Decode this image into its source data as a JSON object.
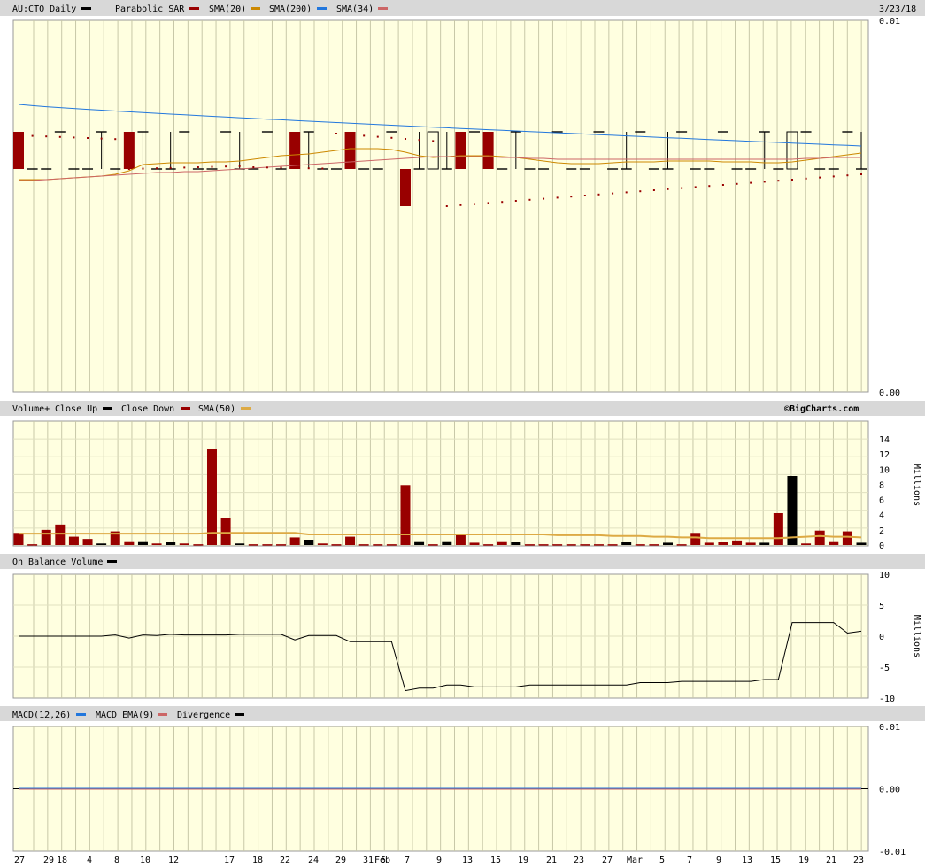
{
  "colors": {
    "panel_bg": "#FFFFE0",
    "header_bg": "#D8D8D8",
    "up": "#000000",
    "down": "#990000",
    "sma20": "#CC8800",
    "sma200": "#2277DD",
    "sma34": "#CC6666",
    "volume_sma50": "#DDAA44",
    "macd": "#2277DD",
    "macd_ema": "#CC6666",
    "divergence": "#000000",
    "sar": "#990000"
  },
  "price_panel": {
    "title": "AU:CTO Daily",
    "date": "3/23/18",
    "legend": [
      "Parabolic SAR",
      "SMA(20)",
      "SMA(200)",
      "SMA(34)"
    ],
    "legend_colors": [
      "#990000",
      "#CC8800",
      "#2277DD",
      "#CC6666"
    ],
    "y_top_label": "0.01",
    "y_bottom_label": "0.00"
  },
  "volume_panel": {
    "title": "Volume+",
    "legend": [
      "Close Up",
      "Close Down",
      "SMA(50)"
    ],
    "legend_colors": [
      "#000000",
      "#990000",
      "#DDAA44"
    ],
    "credit": "©BigCharts.com",
    "unit": "Millions",
    "ticks": [
      "14",
      "12",
      "10",
      "8",
      "6",
      "4",
      "2",
      "0"
    ]
  },
  "obv_panel": {
    "title": "On Balance Volume",
    "unit": "Millions",
    "ticks": [
      "10",
      "5",
      "0",
      "-5",
      "-10"
    ]
  },
  "macd_panel": {
    "title": "MACD(12,26)",
    "legend": [
      "MACD EMA(9)",
      "Divergence"
    ],
    "legend_colors": [
      "#2277DD",
      "#CC6666",
      "#000000"
    ],
    "ticks": [
      "0.01",
      "0.00",
      "-0.01"
    ]
  },
  "x_axis": {
    "labels": [
      "27",
      "29",
      "18",
      "4",
      "8",
      "10",
      "12",
      "17",
      "18",
      "22",
      "24",
      "29",
      "31",
      "Feb",
      "5",
      "7",
      "9",
      "13",
      "15",
      "19",
      "21",
      "23",
      "27",
      "Mar",
      "5",
      "7",
      "9",
      "13",
      "15",
      "19",
      "21",
      "23"
    ]
  },
  "chart_data": [
    {
      "type": "bar",
      "name": "Volume+",
      "unit": "Millions",
      "ylim": [
        0,
        14
      ],
      "values": [
        1.6,
        0.1,
        2.0,
        2.7,
        1.1,
        0.8,
        0.2,
        1.8,
        0.5,
        0.5,
        0.2,
        0.4,
        0.2,
        0.1,
        12.6,
        3.5,
        0.2,
        0.1,
        0.1,
        0.1,
        1.0,
        0.7,
        0.2,
        0.1,
        1.1,
        0.1,
        0.1,
        0.1,
        7.9,
        0.5,
        0.1,
        0.5,
        1.4,
        0.3,
        0.1,
        0.5,
        0.4,
        0.1,
        0.1,
        0.1,
        0.1,
        0.1,
        0.1,
        0.1,
        0.4,
        0.1,
        0.1,
        0.3,
        0.1,
        1.6,
        0.3,
        0.4,
        0.6,
        0.3,
        0.3,
        4.2,
        9.1,
        0.2,
        1.9,
        0.5,
        1.8,
        0.3
      ],
      "direction": [
        "d",
        "d",
        "d",
        "d",
        "d",
        "d",
        "u",
        "d",
        "d",
        "u",
        "d",
        "u",
        "d",
        "d",
        "d",
        "d",
        "u",
        "d",
        "d",
        "d",
        "d",
        "u",
        "d",
        "d",
        "d",
        "d",
        "d",
        "d",
        "d",
        "u",
        "d",
        "u",
        "d",
        "d",
        "d",
        "d",
        "u",
        "d",
        "d",
        "d",
        "d",
        "d",
        "d",
        "d",
        "u",
        "d",
        "d",
        "u",
        "d",
        "d",
        "d",
        "d",
        "d",
        "d",
        "u",
        "d",
        "u",
        "d",
        "d",
        "d",
        "d",
        "u"
      ],
      "sma50": [
        1.5,
        1.5,
        1.5,
        1.5,
        1.5,
        1.5,
        1.5,
        1.5,
        1.5,
        1.5,
        1.5,
        1.5,
        1.5,
        1.5,
        1.6,
        1.6,
        1.6,
        1.6,
        1.6,
        1.6,
        1.6,
        1.4,
        1.4,
        1.4,
        1.4,
        1.4,
        1.4,
        1.4,
        1.4,
        1.4,
        1.4,
        1.4,
        1.4,
        1.4,
        1.4,
        1.4,
        1.4,
        1.4,
        1.4,
        1.3,
        1.3,
        1.3,
        1.3,
        1.2,
        1.2,
        1.2,
        1.1,
        1.1,
        1.0,
        1.0,
        0.9,
        0.9,
        0.9,
        0.9,
        0.9,
        0.9,
        1.0,
        1.1,
        1.2,
        1.1,
        1.1,
        1.0
      ]
    },
    {
      "type": "line",
      "name": "On Balance Volume",
      "unit": "Millions",
      "ylim": [
        -10,
        10
      ],
      "values": [
        0,
        0,
        0,
        0,
        0,
        0,
        0,
        0.2,
        -0.3,
        0.2,
        0.1,
        0.3,
        0.2,
        0.2,
        0.2,
        0.2,
        0.3,
        0.3,
        0.3,
        0.3,
        -0.6,
        0.1,
        0.1,
        0.1,
        -0.9,
        -0.9,
        -0.9,
        -0.9,
        -8.8,
        -8.4,
        -8.4,
        -7.9,
        -7.9,
        -8.2,
        -8.2,
        -8.2,
        -8.2,
        -7.9,
        -7.9,
        -7.9,
        -7.9,
        -7.9,
        -7.9,
        -7.9,
        -7.9,
        -7.5,
        -7.5,
        -7.5,
        -7.3,
        -7.3,
        -7.3,
        -7.3,
        -7.3,
        -7.3,
        -7.0,
        -7.0,
        2.2,
        2.2,
        2.2,
        2.2,
        0.5,
        0.8
      ]
    },
    {
      "type": "line",
      "name": "MACD(12,26)",
      "ylim": [
        -0.01,
        0.01
      ],
      "values": [
        0,
        0,
        0,
        0,
        0,
        0,
        0,
        0,
        0,
        0,
        0,
        0,
        0,
        0,
        0,
        0,
        0,
        0,
        0,
        0,
        0,
        0,
        0,
        0,
        0,
        0,
        0,
        0,
        0,
        0,
        0,
        0,
        0,
        0,
        0,
        0,
        0,
        0,
        0,
        0,
        0,
        0,
        0,
        0,
        0,
        0,
        0,
        0,
        0,
        0,
        0,
        0,
        0,
        0,
        0,
        0,
        0,
        0,
        0,
        0,
        0,
        0
      ]
    }
  ]
}
